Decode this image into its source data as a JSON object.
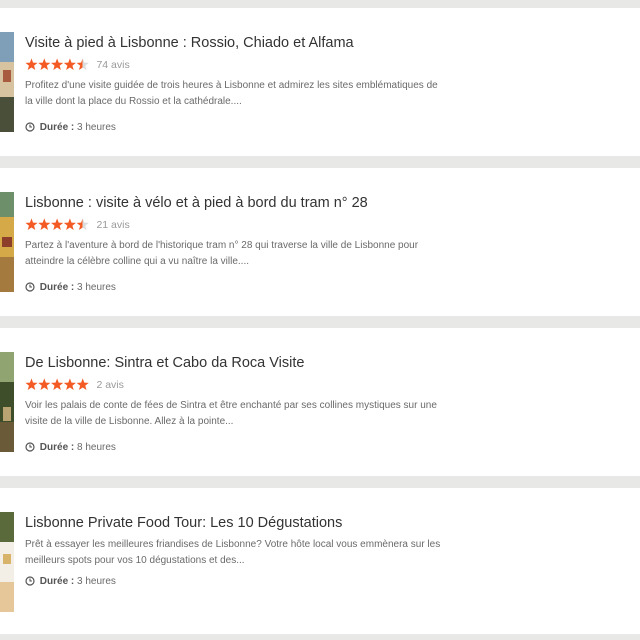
{
  "colors": {
    "star": "#f45b24",
    "star_empty": "#dcdcdc",
    "background": "#e8e8e6"
  },
  "duration_label": "Durée :",
  "tours": [
    {
      "title": "Visite à pied à Lisbonne : Rossio, Chiado et Alfama",
      "rating": 4.5,
      "reviews": "74 avis",
      "description": "Profitez d'une visite guidée de trois heures à Lisbonne et admirez les sites emblématiques de la ville dont la place du Rossio et la cathédrale....",
      "duration": "3 heures",
      "thumb_icon": "tour-photo-icon"
    },
    {
      "title": "Lisbonne : visite à vélo et à pied à bord du tram n° 28",
      "rating": 4.5,
      "reviews": "21 avis",
      "description": "Partez à l'aventure à bord de l'historique tram n° 28 qui traverse la ville de Lisbonne pour atteindre la célèbre colline qui a vu naître la ville....",
      "duration": "3 heures",
      "thumb_icon": "tour-photo-icon"
    },
    {
      "title": "De Lisbonne: Sintra et Cabo da Roca Visite",
      "rating": 5,
      "reviews": "2 avis",
      "description": "Voir les palais de conte de fées de Sintra et être enchanté par ses collines mystiques sur une visite de la ville de Lisbonne. Allez à la pointe...",
      "duration": "8 heures",
      "thumb_icon": "tour-photo-icon"
    },
    {
      "title": "Lisbonne Private Food Tour: Les 10 Dégustations",
      "rating": null,
      "reviews": "",
      "description": "Prêt à essayer les meilleures friandises de Lisbonne? Votre hôte local vous emmènera sur les meilleurs spots pour vos 10 dégustations et des...",
      "duration": "3 heures",
      "thumb_icon": "tour-photo-icon"
    }
  ]
}
